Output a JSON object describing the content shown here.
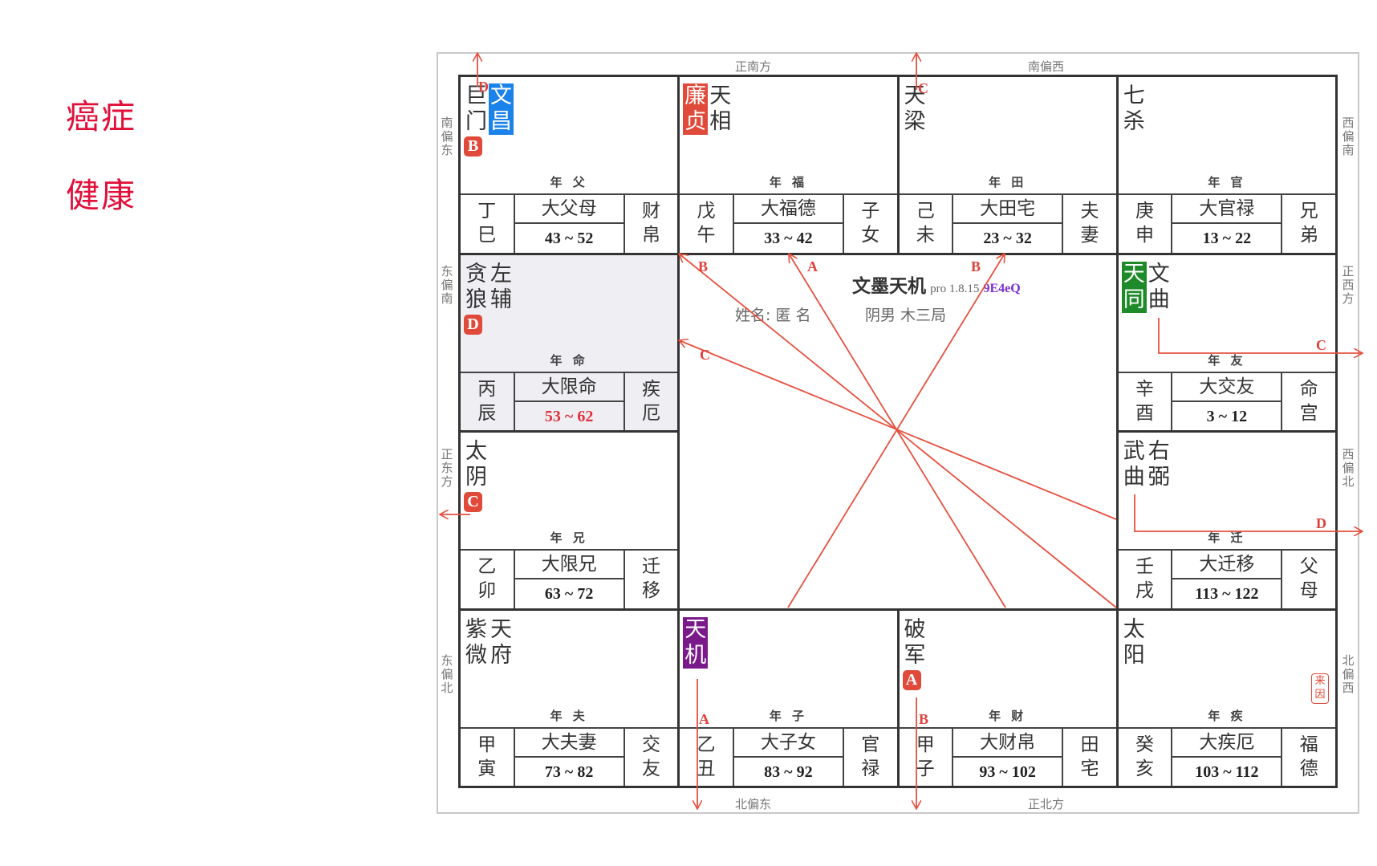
{
  "sidebar": {
    "items": [
      {
        "label": "癌症"
      },
      {
        "label": "健康"
      }
    ]
  },
  "colors": {
    "title_red": "#e0103a",
    "arrow_red": "#e5513f",
    "blue": "#1a82e8",
    "red": "#e04a3a",
    "green": "#1f8a2a",
    "purple": "#7a1a8a"
  },
  "directions": {
    "top": [
      "正南方",
      "南偏西"
    ],
    "bottom": [
      "北偏东",
      "正北方"
    ],
    "left": [
      "南偏东",
      "东偏南",
      "正东方",
      "东偏北"
    ],
    "right": [
      "西偏南",
      "正西方",
      "西偏北",
      "北偏西"
    ]
  },
  "center": {
    "app_name": "文墨天机",
    "version": "pro 1.8.15",
    "code": "9E4eQ",
    "name": "姓名: 匿 名",
    "gender_ju": "阴男 木三局"
  },
  "arrow_labels": [
    "B",
    "A",
    "B",
    "C",
    "D",
    "C",
    "C",
    "D",
    "A",
    "B"
  ],
  "palaces": [
    {
      "row": 0,
      "col": 0,
      "stars": [
        {
          "t": "巨门"
        },
        {
          "t": "文昌",
          "bg": "#1a82e8"
        }
      ],
      "badge": "B",
      "year": "年 父",
      "gz": "丁巳",
      "dx": "大父母",
      "range": "43 ~ 52",
      "palace": "财帛"
    },
    {
      "row": 0,
      "col": 1,
      "stars": [
        {
          "t": "廉贞",
          "bg": "#e04a3a"
        },
        {
          "t": "天相"
        }
      ],
      "year": "年 福",
      "gz": "戊午",
      "dx": "大福德",
      "range": "33 ~ 42",
      "palace": "子女"
    },
    {
      "row": 0,
      "col": 2,
      "stars": [
        {
          "t": "天梁"
        }
      ],
      "year": "年 田",
      "gz": "己未",
      "dx": "大田宅",
      "range": "23 ~ 32",
      "palace": "夫妻"
    },
    {
      "row": 0,
      "col": 3,
      "stars": [
        {
          "t": "七杀"
        }
      ],
      "year": "年 官",
      "gz": "庚申",
      "dx": "大官禄",
      "range": "13 ~ 22",
      "palace": "兄弟"
    },
    {
      "row": 1,
      "col": 0,
      "stars": [
        {
          "t": "贪狼"
        },
        {
          "t": "左辅"
        }
      ],
      "badge": "D",
      "year": "年 命",
      "gz": "丙辰",
      "dx": "大限命",
      "range": "53 ~ 62",
      "range_red": true,
      "palace": "疾厄",
      "current": true
    },
    {
      "row": 1,
      "col": 3,
      "stars": [
        {
          "t": "天同",
          "bg": "#1f8a2a"
        },
        {
          "t": "文曲"
        }
      ],
      "year": "年 友",
      "gz": "辛酉",
      "dx": "大交友",
      "range": "3 ~ 12",
      "palace": "命宫"
    },
    {
      "row": 2,
      "col": 0,
      "stars": [
        {
          "t": "太阴"
        }
      ],
      "badge": "C",
      "year": "年 兄",
      "gz": "乙卯",
      "dx": "大限兄",
      "range": "63 ~ 72",
      "palace": "迁移"
    },
    {
      "row": 2,
      "col": 3,
      "stars": [
        {
          "t": "武曲"
        },
        {
          "t": "右弼"
        }
      ],
      "year": "年 迁",
      "gz": "壬戌",
      "dx": "大迁移",
      "range": "113 ~ 122",
      "palace": "父母"
    },
    {
      "row": 3,
      "col": 0,
      "stars": [
        {
          "t": "紫微"
        },
        {
          "t": "天府"
        }
      ],
      "year": "年 夫",
      "gz": "甲寅",
      "dx": "大夫妻",
      "range": "73 ~ 82",
      "palace": "交友"
    },
    {
      "row": 3,
      "col": 1,
      "stars": [
        {
          "t": "天机",
          "bg": "#7a1a8a"
        }
      ],
      "year": "年 子",
      "gz": "乙丑",
      "dx": "大子女",
      "range": "83 ~ 92",
      "palace": "官禄"
    },
    {
      "row": 3,
      "col": 2,
      "stars": [
        {
          "t": "破军"
        }
      ],
      "badge": "A",
      "year": "年 财",
      "gz": "甲子",
      "dx": "大财帛",
      "range": "93 ~ 102",
      "palace": "田宅"
    },
    {
      "row": 3,
      "col": 3,
      "stars": [
        {
          "t": "太阳"
        }
      ],
      "stamp": "来因",
      "year": "年 疾",
      "gz": "癸亥",
      "dx": "大疾厄",
      "range": "103 ~ 112",
      "palace": "福德"
    }
  ]
}
